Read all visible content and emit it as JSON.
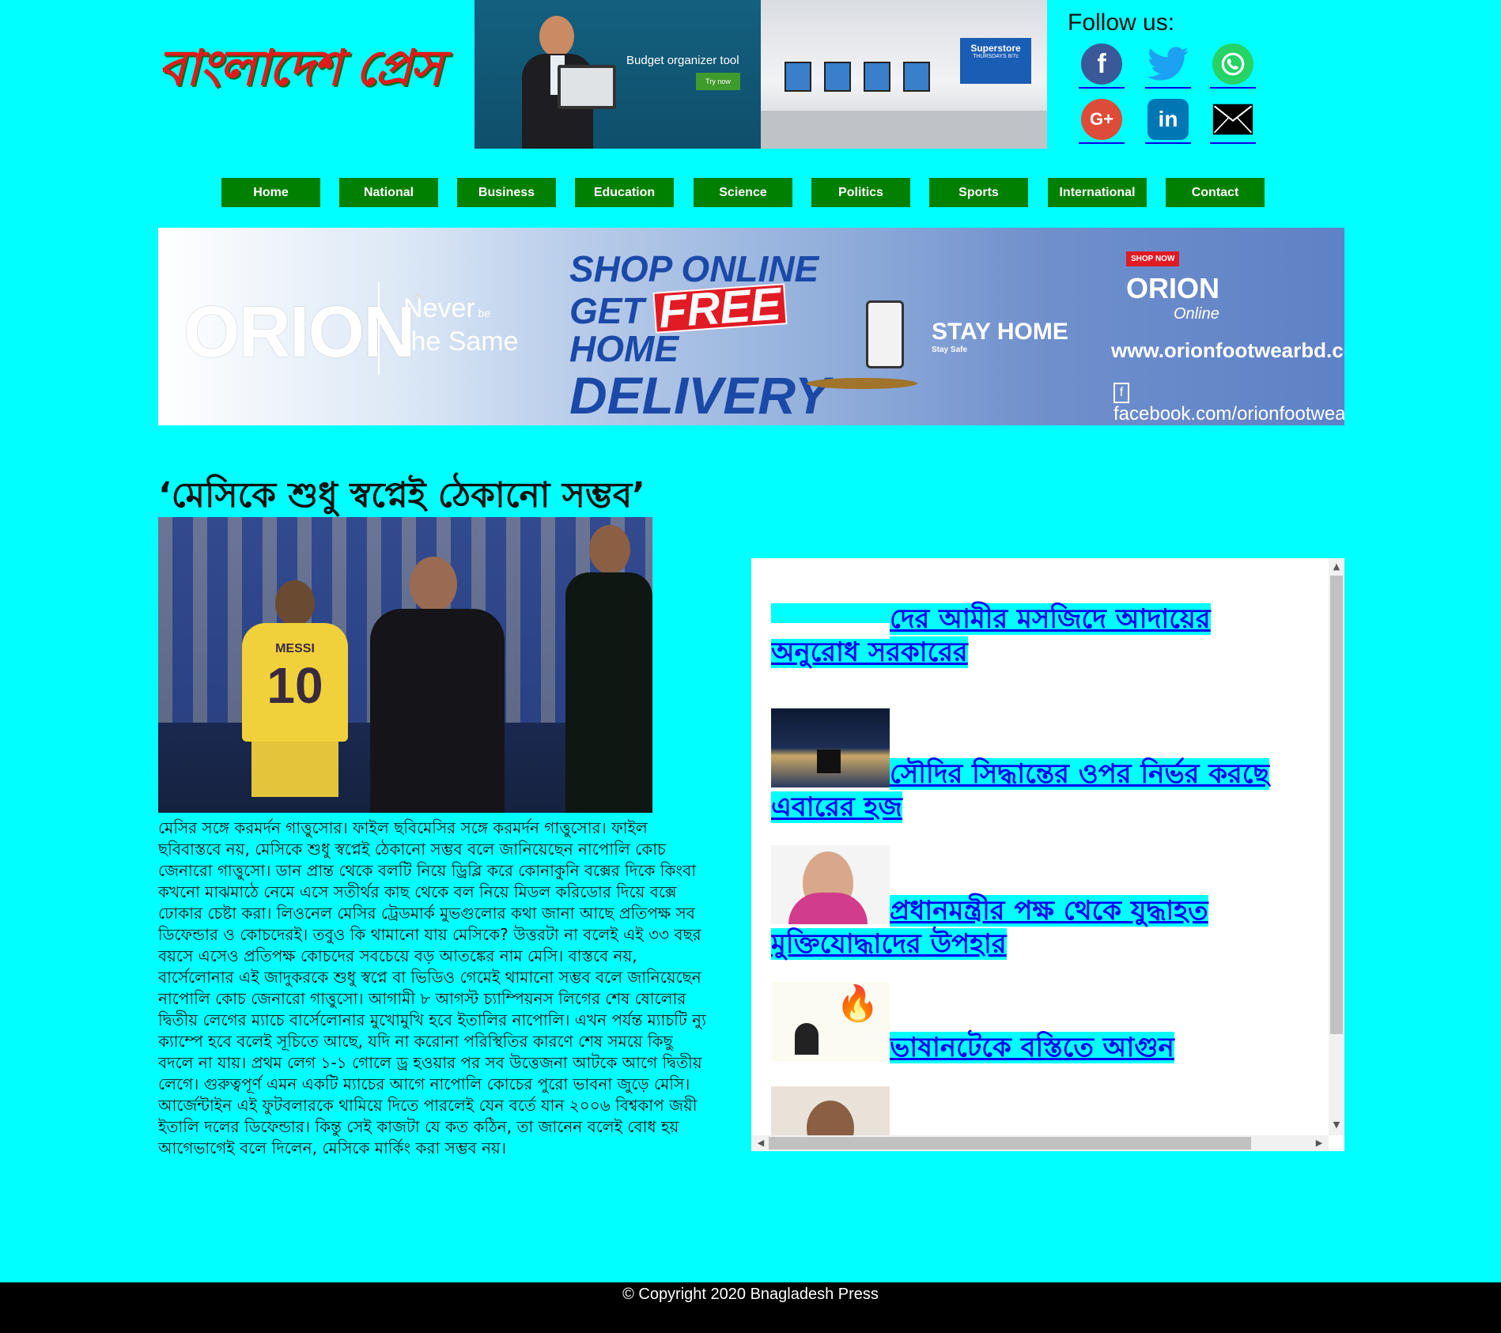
{
  "header": {
    "logo_text": "বাংলাদেশ প্রেস",
    "top_ad": {
      "left_text": "Budget organizer tool",
      "left_button": "Try now",
      "right_text": "Superstore",
      "right_subtext": "THURSDAYS 8/7c"
    },
    "follow_label": "Follow us:",
    "social": [
      {
        "name": "facebook",
        "glyph": "f",
        "color": "#3b5998"
      },
      {
        "name": "twitter",
        "glyph": "t",
        "color": "#1da1f2"
      },
      {
        "name": "whatsapp",
        "glyph": "w",
        "color": "#25d366"
      },
      {
        "name": "google-plus",
        "glyph": "G+",
        "color": "#dd4b39"
      },
      {
        "name": "linkedin",
        "glyph": "in",
        "color": "#0077b5"
      },
      {
        "name": "email",
        "glyph": "✉",
        "color": "#000000"
      }
    ]
  },
  "nav": [
    {
      "label": "Home"
    },
    {
      "label": "National"
    },
    {
      "label": "Business"
    },
    {
      "label": "Education"
    },
    {
      "label": "Science"
    },
    {
      "label": "Politics"
    },
    {
      "label": "Sports"
    },
    {
      "label": "International"
    },
    {
      "label": "Contact"
    }
  ],
  "banner": {
    "brand": "ORION",
    "tagline_1": "Never",
    "tagline_2": "be",
    "tagline_3": "the Same",
    "shop_online": "SHOP ONLINE",
    "get": "GET",
    "free": "FREE",
    "home": "HOME",
    "delivery": "DELIVERY",
    "stay_home": "STAY HOME",
    "stay_safe": "Stay Safe",
    "shop_now": "SHOP NOW",
    "orion_online": "ORION",
    "online": "Online",
    "website": "www.orionfootwearbd.com",
    "facebook": "facebook.com/orionfootwearbd"
  },
  "article": {
    "headline": "‘মেসিকে শুধু স্বপ্নেই ঠেকানো সম্ভব’",
    "photo_jersey_name": "MESSI",
    "photo_jersey_number": "10",
    "body": "মেসির সঙ্গে করমর্দন গাত্তুসোর। ফাইল ছবিমেসির সঙ্গে করমর্দন গাত্তুসোর। ফাইল ছবিবাস্তবে নয়, মেসিকে শুধু স্বপ্নেই ঠেকানো সম্ভব বলে জানিয়েছেন নাপোলি কোচ জেনারো গাত্তুসো। ডান প্রান্ত থেকে বলটি নিয়ে ড্রিব্লি করে কোনাকুনি বক্সের দিকে কিংবা কখনো মাঝমাঠে নেমে এসে সতীর্থর কাছ থেকে বল নিয়ে মিডল করিডোর দিয়ে বক্সে ঢোকার চেষ্টা করা। লিওনেল মেসির ট্রেডমার্ক মুভগুলোর কথা জানা আছে প্রতিপক্ষ সব ডিফেন্ডার ও কোচদেরই। তবুও কি থামানো যায় মেসিকে? উত্তরটা না বলেই এই ৩৩ বছর বয়সে এসেও প্রতিপক্ষ কোচদের সবচেয়ে বড় আতঙ্কের নাম মেসি। বাস্তবে নয়, বার্সেলোনার এই জাদুকরকে শুধু স্বপ্নে বা ভিডিও গেমেই থামানো সম্ভব বলে জানিয়েছেন নাপোলি কোচ জেনারো গাত্তুসো। আগামী ৮ আগস্ট চ্যাম্পিয়নস লিগের শেষ ষোলোর দ্বিতীয় লেগের ম্যাচে বার্সেলোনার মুখোমুখি হবে ইতালির নাপোলি। এখন পর্যন্ত ম্যাচটি ন্যু ক্যাম্পে হবে বলেই সূচিতে আছে, যদি না করোনা পরিস্থিতির কারণে শেষ সময়ে কিছু বদলে না যায়। প্রথম লেগ ১-১ গোলে ড্র হওয়ার পর সব উত্তেজনা আটকে আগে দ্বিতীয় লেগে। গুরুত্বপূর্ণ এমন একটি ম্যাচের আগে নাপোলি কোচের পুরো ভাবনা জুড়ে মেসি। আর্জেন্টাইন এই ফুটবলারকে থামিয়ে দিতে পারলেই যেন বর্তে যান ২০০৬ বিশ্বকাপ জয়ী ইতালি দলের ডিফেন্ডার। কিন্তু সেই কাজটা যে কত কঠিন, তা জানেন বলেই বোধ হয় আগেভাগেই বলে দিলেন, মেসিকে মার্কিং করা সম্ভব নয়।"
  },
  "sidebar": {
    "items": [
      {
        "title": "দের আমীর মসজিদে আদায়ের অনুরোধ সরকারের",
        "thumb": "notice"
      },
      {
        "title": "সৌদির সিদ্ধান্তের ওপর নির্ভর করছে এবারের হজ",
        "thumb": "kaaba"
      },
      {
        "title": "প্রধানমন্ত্রীর পক্ষ থেকে যুদ্ধাহত মুক্তিযোদ্ধাদের উপহার",
        "thumb": "pm"
      },
      {
        "title": "ভাষানটেকে বস্তিতে আগুন",
        "thumb": "fire"
      },
      {
        "title": "",
        "thumb": "person"
      }
    ]
  },
  "footer": {
    "text": "© Copyright 2020 Bnagladesh Press"
  }
}
